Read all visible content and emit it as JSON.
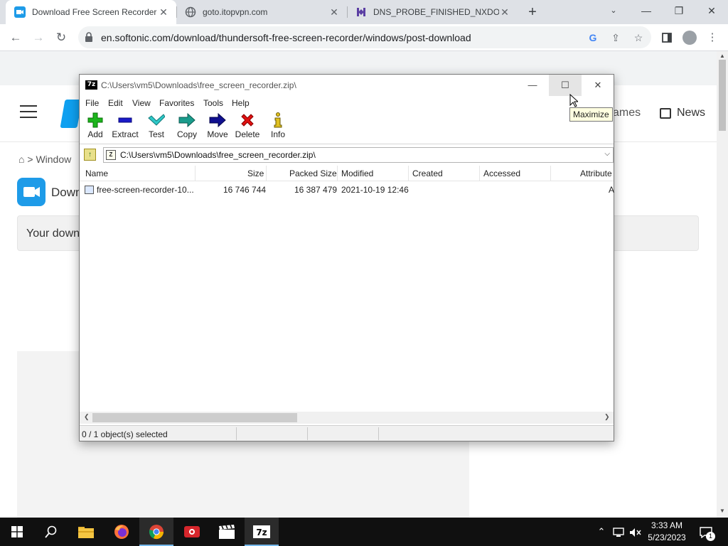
{
  "browser": {
    "tabs": [
      {
        "label": "Download Free Screen Recorder",
        "active": true
      },
      {
        "label": "goto.itopvpn.com",
        "active": false
      },
      {
        "label": "DNS_PROBE_FINISHED_NXDOMAIN",
        "active": false
      }
    ],
    "url": "en.softonic.com/download/thundersoft-free-screen-recorder/windows/post-download",
    "accent": "#1a73e8"
  },
  "site": {
    "nav_games": "ames",
    "nav_news": "News",
    "breadcrumb": "Window",
    "app_title": "Down",
    "download_banner": "Your down"
  },
  "sevenzip": {
    "title": "C:\\Users\\vm5\\Downloads\\free_screen_recorder.zip\\",
    "menu": [
      "File",
      "Edit",
      "View",
      "Favorites",
      "Tools",
      "Help"
    ],
    "toolbar": [
      {
        "label": "Add",
        "icon": "plus-icon"
      },
      {
        "label": "Extract",
        "icon": "minus-icon"
      },
      {
        "label": "Test",
        "icon": "check-icon"
      },
      {
        "label": "Copy",
        "icon": "copy-arrow-icon"
      },
      {
        "label": "Move",
        "icon": "move-arrow-icon"
      },
      {
        "label": "Delete",
        "icon": "delete-x-icon"
      },
      {
        "label": "Info",
        "icon": "info-icon"
      }
    ],
    "address": "C:\\Users\\vm5\\Downloads\\free_screen_recorder.zip\\",
    "columns": [
      "Name",
      "Size",
      "Packed Size",
      "Modified",
      "Created",
      "Accessed",
      "Attribute"
    ],
    "rows": [
      {
        "name": "free-screen-recorder-10...",
        "size": "16 746 744",
        "packed": "16 387 479",
        "modified": "2021-10-19 12:46",
        "created": "",
        "accessed": "",
        "attributes": "A"
      }
    ],
    "status": "0 / 1 object(s) selected",
    "tooltip": "Maximize"
  },
  "taskbar": {
    "time": "3:33 AM",
    "date": "5/23/2023",
    "notifications": "1"
  }
}
